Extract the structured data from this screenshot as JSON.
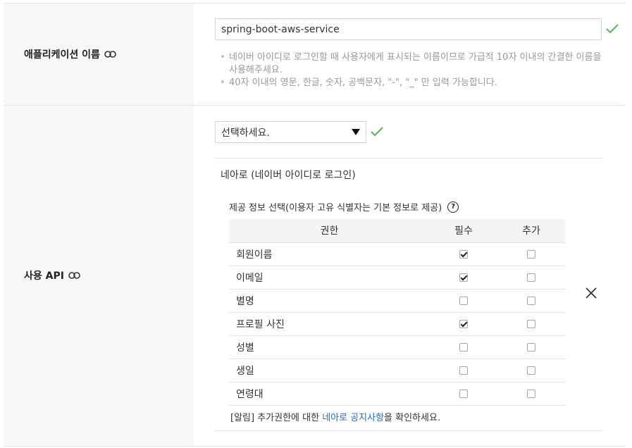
{
  "app_name": {
    "label": "애플리케이션 이름",
    "value": "spring-boot-aws-service",
    "help": [
      "네이버 아이디로 로그인할 때 사용자에게 표시되는 이름이므로 가급적 10자 이내의 간결한 이름을 사용해주세요.",
      "40자 이내의 영문, 한글, 숫자, 공백문자, \"-\", \"_\" 만 입력 가능합니다."
    ]
  },
  "api": {
    "label": "사용 API",
    "select_value": "선택하세요.",
    "section_title": "네아로 (네이버 아이디로 로그인)",
    "info_title": "제공 정보 선택(이용자 고유 식별자는 기본 정보로 제공)",
    "help_icon": "?",
    "columns": [
      "권한",
      "필수",
      "추가"
    ],
    "rows": [
      {
        "name": "회원이름",
        "required": true,
        "extra": false
      },
      {
        "name": "이메일",
        "required": true,
        "extra": false
      },
      {
        "name": "별명",
        "required": false,
        "extra": false
      },
      {
        "name": "프로필 사진",
        "required": true,
        "extra": false
      },
      {
        "name": "성별",
        "required": false,
        "extra": false
      },
      {
        "name": "생일",
        "required": false,
        "extra": false
      },
      {
        "name": "연령대",
        "required": false,
        "extra": false
      }
    ],
    "notice_prefix": "[알림] 추가권한에 대한 ",
    "notice_link": "네아로 공지사항",
    "notice_suffix": "을 확인하세요."
  },
  "colors": {
    "check": "#5cb85c",
    "link": "#2b6cb0",
    "label_bg": "#f7f7f7"
  }
}
